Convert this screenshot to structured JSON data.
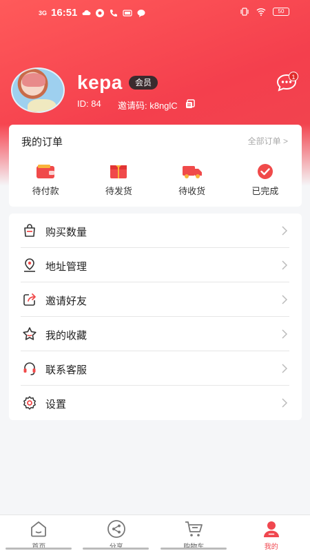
{
  "status_bar": {
    "signal": "3G",
    "time": "16:51",
    "battery": "50"
  },
  "profile": {
    "username": "kepa",
    "badge": "会员",
    "id_label": "ID: 84",
    "invite_label": "邀请码: k8nglC",
    "message_count": "1"
  },
  "orders": {
    "title": "我的订单",
    "all_link": "全部订单 >",
    "items": [
      {
        "label": "待付款",
        "icon": "wallet-icon"
      },
      {
        "label": "待发货",
        "icon": "gift-box-icon"
      },
      {
        "label": "待收货",
        "icon": "truck-icon"
      },
      {
        "label": "已完成",
        "icon": "check-circle-icon"
      }
    ]
  },
  "menu": {
    "items": [
      {
        "label": "购买数量",
        "icon": "bag-icon"
      },
      {
        "label": "地址管理",
        "icon": "location-pin-icon"
      },
      {
        "label": "邀请好友",
        "icon": "share-out-icon"
      },
      {
        "label": "我的收藏",
        "icon": "star-icon"
      },
      {
        "label": "联系客服",
        "icon": "headset-icon"
      },
      {
        "label": "设置",
        "icon": "gear-icon"
      }
    ]
  },
  "nav": {
    "items": [
      {
        "label": "首页",
        "icon": "home-icon"
      },
      {
        "label": "分享",
        "icon": "share-icon"
      },
      {
        "label": "购物车",
        "icon": "cart-icon"
      },
      {
        "label": "我的",
        "icon": "user-icon",
        "active": true
      }
    ]
  },
  "colors": {
    "accent": "#f0474f",
    "header_start": "#ff5a5a",
    "badge_bg": "#3a2b2e"
  }
}
